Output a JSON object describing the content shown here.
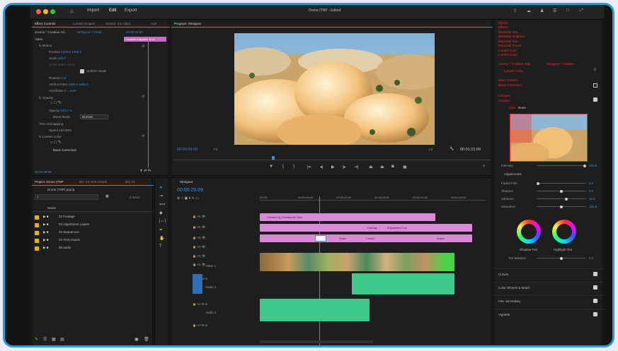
{
  "titlebar": {
    "menu": [
      "Import",
      "Edit",
      "Export"
    ],
    "document": "Drone (TNP",
    "status": "Edited"
  },
  "effect_controls": {
    "tabs": [
      "Effect Controls",
      "Lumetri Scopes",
      "Source: (no clips)",
      "Aud"
    ],
    "source": "Source * Creative Ad...",
    "sequence": "Stringout * Creati...",
    "timecode": "00:00:24:00",
    "clip_label": "Creative Adjustment La",
    "section": "Video",
    "rows": [
      {
        "label": "fx Motion",
        "value": ""
      },
      {
        "label": "Position",
        "value": "1920.0  1080.0"
      },
      {
        "label": "Scale",
        "value": "100.0"
      },
      {
        "label": "Scale Width",
        "value": "100.0"
      },
      {
        "label": "Uniform Scale",
        "value": ""
      },
      {
        "label": "Rotation",
        "value": "0.0"
      },
      {
        "label": "Anchor Point",
        "value": "1920.0  1080.0"
      },
      {
        "label": "Anti-flicker F...",
        "value": "0.00"
      },
      {
        "label": "fx Opacity",
        "value": ""
      },
      {
        "label": "Opacity",
        "value": "100.0 %"
      },
      {
        "label": "Blend Mode",
        "value": "Normal"
      },
      {
        "label": "Time Remapping",
        "value": ""
      },
      {
        "label": "Speed",
        "value": "100.00%"
      },
      {
        "label": "fx Lumetri Color",
        "value": ""
      },
      {
        "label": "Basic Correction",
        "value": ""
      }
    ],
    "footer_timecode": "00:00:25:09"
  },
  "program": {
    "tab": "Program: Stringout",
    "timecode": "00:00:25:09",
    "fit": "Fit",
    "ratio": "1/2",
    "duration": "00:01:21:09"
  },
  "project": {
    "tabs": [
      "Project: Drone (TNP",
      "Bin: 04 VHS Assets",
      "Bin: 01"
    ],
    "file": "Drone (TNP).prproj",
    "items_count": "5 items",
    "column": "Name",
    "items": [
      {
        "name": "01 Footage",
        "color": "#e6b400"
      },
      {
        "name": "02 Adjustment Layers",
        "color": "#e6b400"
      },
      {
        "name": "03 Sequences",
        "color": "#e6b400"
      },
      {
        "name": "04 VHS Assets",
        "color": "#e6b400"
      },
      {
        "name": "05 audio",
        "color": "#e6b400"
      }
    ]
  },
  "timeline": {
    "tab": "Stringout",
    "timecode": "00:00:25:09",
    "ruler": [
      "00:00",
      "00:00:16:00",
      "00:00:32:00",
      "00:00:48:00",
      "00:01:04:00",
      "00:01:20:00"
    ],
    "tracks": [
      "V6",
      "V5",
      "V4",
      "V3",
      "V2",
      "V1",
      "A1",
      "A2",
      "A3"
    ],
    "track_names": {
      "v1": "Video 1",
      "a1": "Audio 1",
      "a2": "Audio 2"
    },
    "clips": {
      "credit": "Created by Christopher Alan",
      "overlay": "Overlay",
      "adjustment": "Adjustment Lay",
      "grain": "Grain",
      "color": "Colour",
      "adjust": "Adjust"
    }
  },
  "lumetri": {
    "items": [
      {
        "heading": "Effects",
        "sub": "Effects"
      },
      {
        "heading": "Essential Gra",
        "sub": "Essential Graphics"
      },
      {
        "heading": "Essential Sou",
        "sub": "Essential Sound"
      },
      {
        "heading": "Lumetri Colo",
        "sub": "Lumetri Color"
      }
    ],
    "source": "Source * Creative Adju",
    "sequence": "Stringout * Creative...",
    "effect": "Lumetri Color",
    "basic_heading": "Basic Correct",
    "basic": "Basic Correction",
    "creative_heading": "Creative",
    "creative": "Creative",
    "look_label": "Look",
    "look_value": "None",
    "intensity_label": "Intensity",
    "intensity_value": "100.0",
    "adjustments_title": "Adjustments",
    "adjustments": [
      {
        "label": "Faded Film",
        "value": "0.0"
      },
      {
        "label": "Sharpen",
        "value": "0.0"
      },
      {
        "label": "Vibrance",
        "value": "32.6"
      },
      {
        "label": "Saturation",
        "value": "100.0"
      }
    ],
    "shadow_tint": "Shadow Tint",
    "highlight_tint": "Highlight Tint",
    "tint_balance_label": "Tint Balance",
    "tint_balance_value": "0.0",
    "sections": [
      "Curves",
      "Color Wheels & Match",
      "HSL Secondary",
      "Vignette"
    ]
  }
}
